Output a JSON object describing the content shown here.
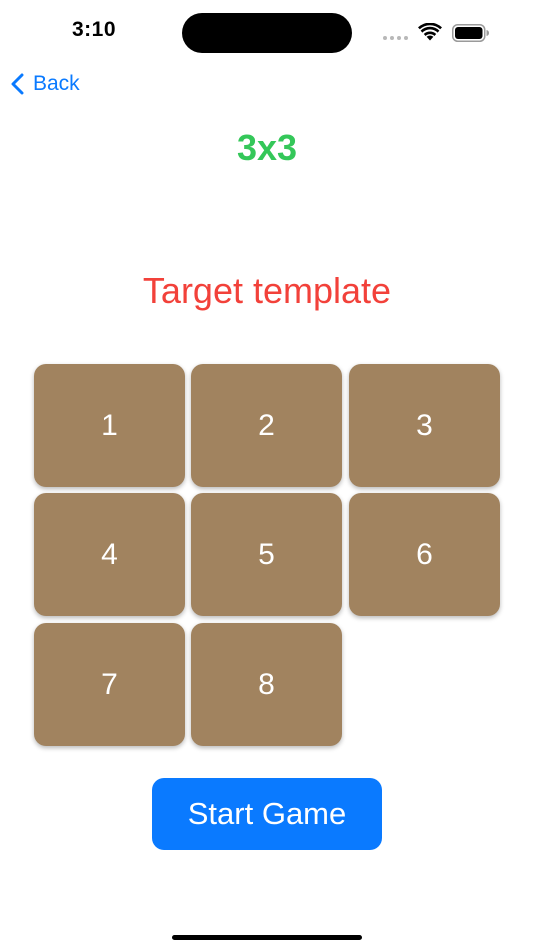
{
  "status_bar": {
    "time": "3:10",
    "icons": [
      "signal-dots-icon",
      "wifi-icon",
      "battery-icon"
    ]
  },
  "nav": {
    "back_label": "Back",
    "back_icon": "chevron-left-icon"
  },
  "title": "3x3",
  "target_label": "Target template",
  "tiles": [
    "1",
    "2",
    "3",
    "4",
    "5",
    "6",
    "7",
    "8"
  ],
  "start_button_label": "Start Game",
  "colors": {
    "title": "#34c759",
    "target_label": "#f2413a",
    "tile": "#a1835f",
    "accent": "#0a7aff"
  }
}
